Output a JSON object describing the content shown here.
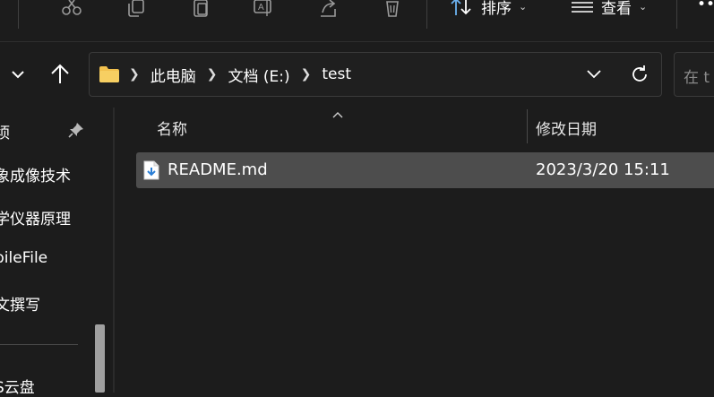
{
  "toolbar": {
    "sort_label": "排序",
    "view_label": "查看",
    "more_label": "••"
  },
  "address": {
    "crumbs": [
      "此电脑",
      "文档 (E:)",
      "test"
    ]
  },
  "search": {
    "placeholder": "在 t"
  },
  "nav_pane": {
    "items": [
      "顷",
      "象成像技术",
      "学仪器原理",
      "bileFile",
      "文撰写",
      "S云盘"
    ]
  },
  "file_list": {
    "columns": {
      "name": "名称",
      "modified": "修改日期"
    },
    "rows": [
      {
        "name": "README.md",
        "modified": "2023/3/20 15:11"
      }
    ]
  },
  "colors": {
    "background": "#1c1c1c",
    "selected_row": "#4d4d4d",
    "folder_yellow": "#f2c14e",
    "file_blue": "#2b7fd6"
  }
}
